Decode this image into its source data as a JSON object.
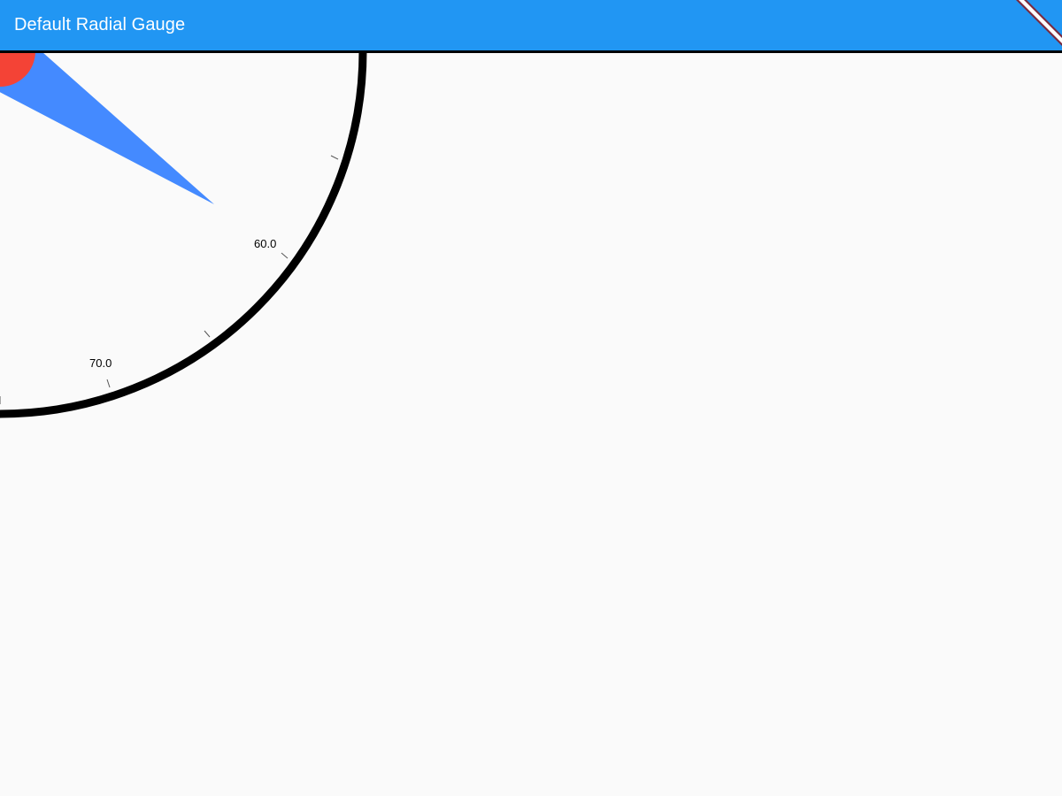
{
  "app_bar": {
    "title": "Default Radial Gauge",
    "background_color": "#2196f3",
    "title_color": "#ffffff"
  },
  "debug_banner": {
    "icon": "debug-banner-icon",
    "color": "#7b2a3e"
  },
  "gauge": {
    "rim_color": "#000000",
    "needle_color": "#448aff",
    "needle_cap_color": "#f44336",
    "tick_color": "#555555",
    "labels": [
      "60.0",
      "70.0"
    ]
  }
}
